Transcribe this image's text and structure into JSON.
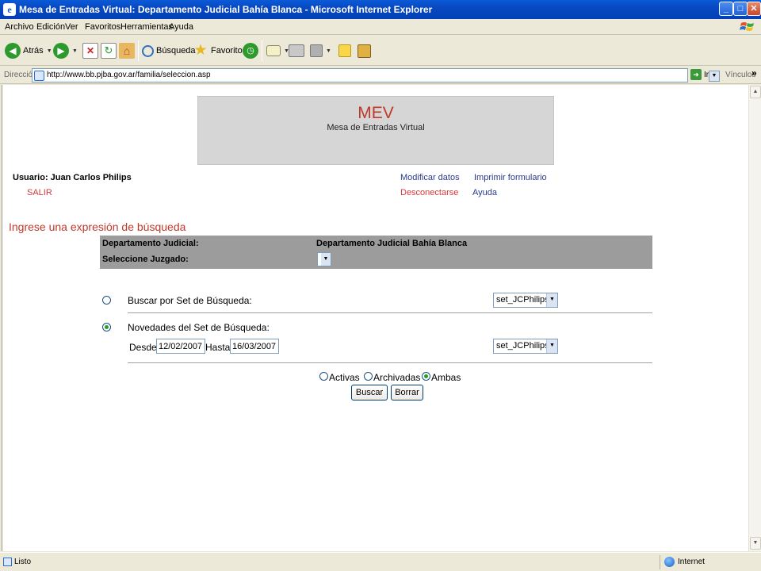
{
  "window": {
    "title": "Mesa de Entradas Virtual: Departamento Judicial Bahía Blanca - Microsoft Internet Explorer"
  },
  "menu": [
    "Archivo",
    "Edición",
    "Ver",
    "Favoritos",
    "Herramientas",
    "Ayuda"
  ],
  "toolbar": {
    "back": "Atrás",
    "search": "Búsqueda",
    "favorites": "Favoritos"
  },
  "address": {
    "label": "Dirección",
    "url": "http://www.bb.pjba.gov.ar/familia/seleccion.asp",
    "go": "Ir",
    "links": "Vínculos"
  },
  "header": {
    "title": "MEV",
    "subtitle": "Mesa de Entradas Virtual"
  },
  "user": {
    "line": "Usuario: Juan Carlos Philips",
    "logout": "SALIR"
  },
  "links": {
    "modify": "Modificar datos",
    "print": "Imprimir formulario",
    "disconnect": "Desconectarse",
    "help": "Ayuda"
  },
  "search": {
    "heading": "Ingrese una expresión de búsqueda",
    "dept_label": "Departamento Judicial:",
    "dept_value": "Departamento Judicial Bahía Blanca",
    "court_label": "Seleccione Juzgado:",
    "opt1_label": "Buscar por Set de Búsqueda:",
    "opt1_select": "set_JCPhilips",
    "opt2_label": "Novedades del Set de Búsqueda:",
    "opt2_select": "set_JCPhilips",
    "from_label": "Desde:",
    "from_value": "12/02/2007",
    "to_label": "Hasta:",
    "to_value": "16/03/2007",
    "filter_active": "Activas",
    "filter_archived": "Archivadas",
    "filter_both": "Ambas",
    "search_button": "Buscar",
    "clear_button": "Borrar"
  },
  "status": {
    "text": "Listo",
    "zone": "Internet"
  }
}
